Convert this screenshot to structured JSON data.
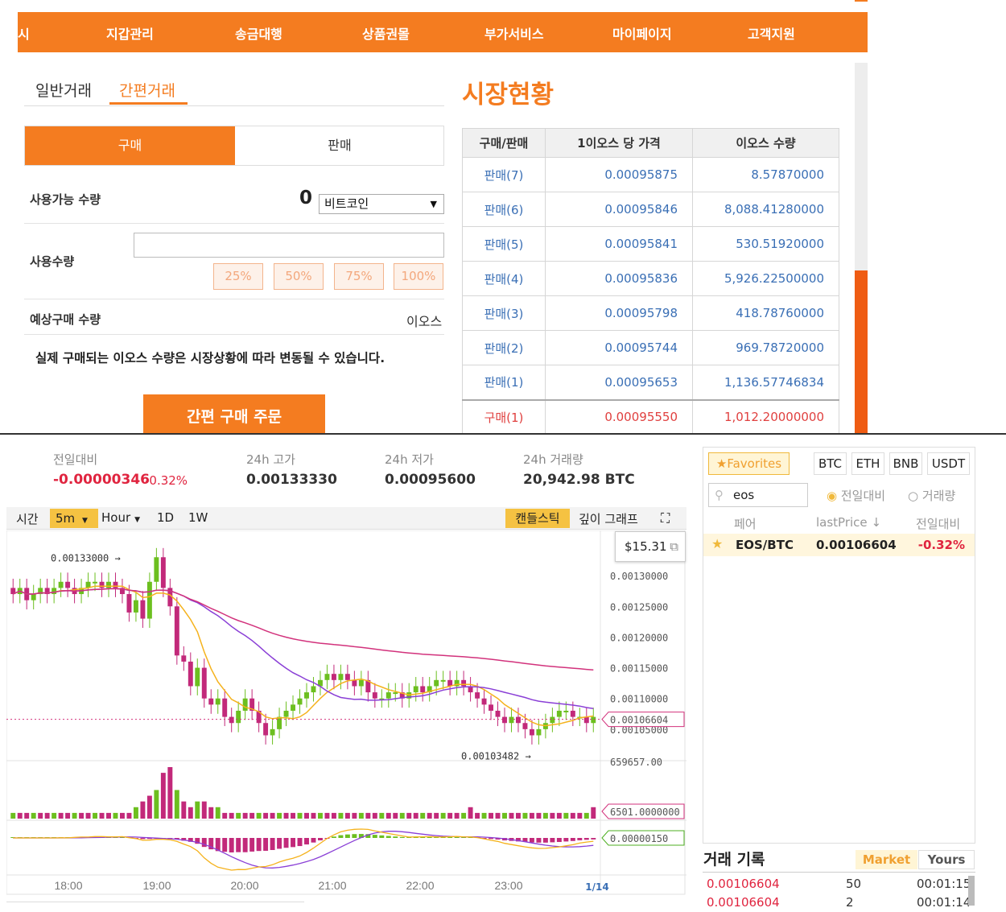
{
  "nav": {
    "items": [
      "시",
      "지갑관리",
      "송금대행",
      "상품권몰",
      "부가서비스",
      "마이페이지",
      "고객지원"
    ]
  },
  "trade_tabs": {
    "normal": "일반거래",
    "quick": "간편거래"
  },
  "buysell": {
    "buy": "구매",
    "sell": "판매"
  },
  "form": {
    "available_label": "사용가능 수량",
    "available_value": "0",
    "coin_select": "비트코인",
    "amount_label": "사용수량",
    "percent_buttons": [
      "25%",
      "50%",
      "75%",
      "100%"
    ],
    "expected_label": "예상구매 수량",
    "expected_unit": "이오스",
    "notice": "실제 구매되는 이오스 수량은 시장상황에 따라 변동될 수 있습니다.",
    "order_button": "간편 구매 주문"
  },
  "market": {
    "title": "시장현황",
    "headers": [
      "구매/판매",
      "1이오스 당 가격",
      "이오스 수량"
    ],
    "rows": [
      {
        "side": "판매(7)",
        "price": "0.00095875",
        "qty": "8.57870000",
        "type": "sell"
      },
      {
        "side": "판매(6)",
        "price": "0.00095846",
        "qty": "8,088.41280000",
        "type": "sell"
      },
      {
        "side": "판매(5)",
        "price": "0.00095841",
        "qty": "530.51920000",
        "type": "sell"
      },
      {
        "side": "판매(4)",
        "price": "0.00095836",
        "qty": "5,926.22500000",
        "type": "sell"
      },
      {
        "side": "판매(3)",
        "price": "0.00095798",
        "qty": "418.78760000",
        "type": "sell"
      },
      {
        "side": "판매(2)",
        "price": "0.00095744",
        "qty": "969.78720000",
        "type": "sell"
      },
      {
        "side": "판매(1)",
        "price": "0.00095653",
        "qty": "1,136.57746834",
        "type": "sell"
      },
      {
        "side": "구매(1)",
        "price": "0.00095550",
        "qty": "1,012.20000000",
        "type": "buy"
      }
    ]
  },
  "stats": {
    "change_label": "전일대비",
    "change_value": "-0.00000346",
    "change_pct": "-0.32%",
    "high_label": "24h 고가",
    "high_value": "0.00133330",
    "low_label": "24h 저가",
    "low_value": "0.00095600",
    "volume_label": "24h 거래량",
    "volume_value": "20,942.98 BTC"
  },
  "toolbar": {
    "time": "시간",
    "interval": "5m",
    "hour": "Hour",
    "d1": "1D",
    "w1": "1W",
    "candle": "캔들스틱",
    "depth": "깊이 그래프"
  },
  "tooltip": {
    "value": "$15.31"
  },
  "chart_data": {
    "type": "candlestick",
    "title": "",
    "x_ticks": [
      "18:00",
      "19:00",
      "20:00",
      "21:00",
      "22:00",
      "23:00"
    ],
    "date_label": "1/14",
    "price_axis": [
      "0.00130000",
      "0.00125000",
      "0.00120000",
      "0.00115000",
      "0.00110000",
      "0.00105000"
    ],
    "current_price_tag": "0.00106604",
    "high_marker": "0.00133000",
    "low_marker": "0.00103482",
    "volume_axis": "659657.00",
    "volume_tag": "6501.0000000",
    "macd_tag": "0.00000150",
    "ylim": [
      0.001,
      0.00135
    ],
    "closes": [
      0.00127,
      0.00128,
      0.00126,
      0.00127,
      0.00128,
      0.00127,
      0.00128,
      0.00129,
      0.00128,
      0.00127,
      0.00128,
      0.00129,
      0.00129,
      0.00128,
      0.00129,
      0.00128,
      0.00127,
      0.00124,
      0.00126,
      0.00123,
      0.00129,
      0.00133,
      0.00128,
      0.00125,
      0.00117,
      0.00116,
      0.00112,
      0.00115,
      0.0011,
      0.00109,
      0.0011,
      0.00107,
      0.00106,
      0.00108,
      0.0011,
      0.00108,
      0.00106,
      0.00104,
      0.00105,
      0.00107,
      0.00108,
      0.00109,
      0.0011,
      0.00111,
      0.00112,
      0.00113,
      0.00114,
      0.00113,
      0.00114,
      0.00113,
      0.00112,
      0.00113,
      0.00111,
      0.0011,
      0.0011,
      0.00111,
      0.00111,
      0.0011,
      0.00111,
      0.00112,
      0.00111,
      0.00112,
      0.00113,
      0.00113,
      0.00112,
      0.00113,
      0.00112,
      0.00111,
      0.0011,
      0.00109,
      0.00108,
      0.00107,
      0.00106,
      0.00107,
      0.00106,
      0.00105,
      0.00104,
      0.00105,
      0.00106,
      0.00107,
      0.00108,
      0.00108,
      0.00107,
      0.00107,
      0.00106,
      0.00107
    ],
    "volumes": [
      1,
      1,
      1,
      1,
      1,
      1,
      1,
      1,
      1,
      1,
      1,
      1,
      1,
      1,
      1,
      1,
      1,
      1,
      2,
      3,
      4,
      5,
      8,
      9,
      5,
      3,
      2,
      3,
      3,
      2,
      2,
      1,
      1,
      1,
      1,
      1,
      1,
      1,
      1,
      1,
      1,
      1,
      1,
      1,
      1,
      1,
      1,
      1,
      1,
      1,
      1,
      1,
      1,
      1,
      1,
      1,
      1,
      1,
      1,
      1,
      1,
      1,
      1,
      1,
      1,
      1,
      1,
      2,
      1,
      1,
      1,
      1,
      1,
      1,
      1,
      1,
      1,
      1,
      1,
      1,
      1,
      1,
      1,
      1,
      1,
      2
    ]
  },
  "pairs": {
    "favorites": "Favorites",
    "markets": [
      "BTC",
      "ETH",
      "BNB",
      "USDT"
    ],
    "search": "eos",
    "radio_change": "전일대비",
    "radio_volume": "거래량",
    "col_pair": "페어",
    "col_price": "lastPrice",
    "col_change": "전일대비",
    "row": {
      "name": "EOS/BTC",
      "price": "0.00106604",
      "change": "-0.32%"
    }
  },
  "trades": {
    "title": "거래 기록",
    "tab_market": "Market",
    "tab_yours": "Yours",
    "rows": [
      {
        "price": "0.00106604",
        "qty": "50",
        "time": "00:01:15"
      },
      {
        "price": "0.00106604",
        "qty": "2",
        "time": "00:01:14"
      }
    ]
  },
  "colors": {
    "brand": "#f47c20",
    "sell": "#3a6fb5",
    "buy": "#e0403f",
    "up": "#6cbf1f",
    "down": "#c2297a"
  }
}
